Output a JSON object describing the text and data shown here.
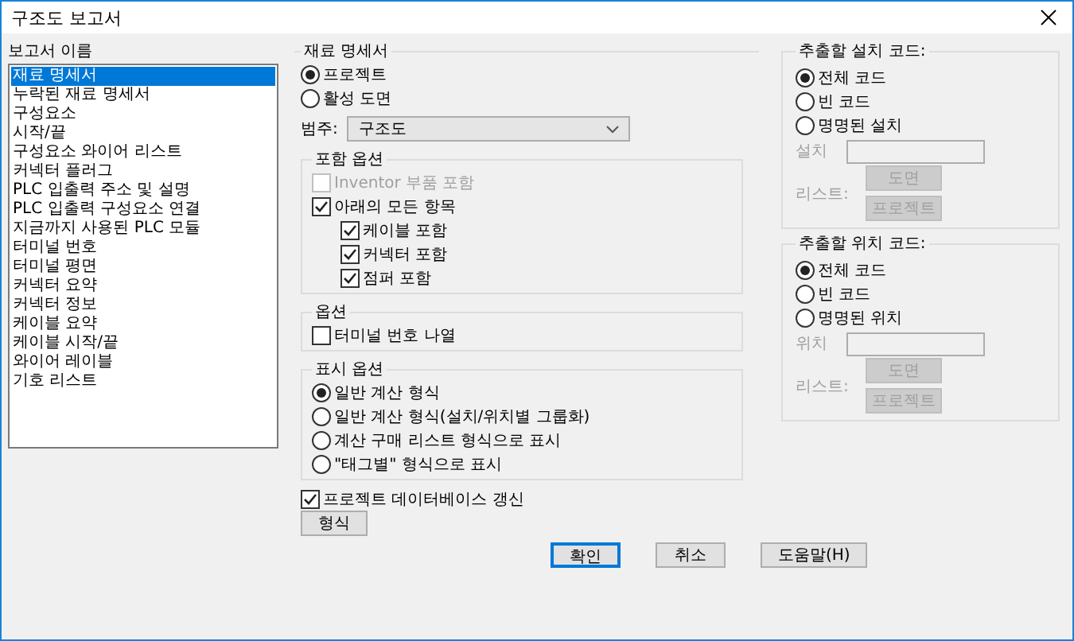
{
  "window": {
    "title": "구조도 보고서"
  },
  "report_list": {
    "label": "보고서 이름",
    "items": [
      {
        "label": "재료 명세서",
        "selected": true
      },
      {
        "label": "누락된 재료 명세서",
        "selected": false
      },
      {
        "label": "구성요소",
        "selected": false
      },
      {
        "label": "시작/끝",
        "selected": false
      },
      {
        "label": "구성요소 와이어 리스트",
        "selected": false
      },
      {
        "label": "커넥터 플러그",
        "selected": false
      },
      {
        "label": "PLC 입출력 주소 및 설명",
        "selected": false
      },
      {
        "label": "PLC 입출력 구성요소 연결",
        "selected": false
      },
      {
        "label": "지금까지 사용된 PLC 모듈",
        "selected": false
      },
      {
        "label": "터미널 번호",
        "selected": false
      },
      {
        "label": "터미널 평면",
        "selected": false
      },
      {
        "label": "커넥터 요약",
        "selected": false
      },
      {
        "label": "커넥터 정보",
        "selected": false
      },
      {
        "label": "케이블 요약",
        "selected": false
      },
      {
        "label": "케이블 시작/끝",
        "selected": false
      },
      {
        "label": "와이어 레이블",
        "selected": false
      },
      {
        "label": "기호 리스트",
        "selected": false
      }
    ]
  },
  "bom": {
    "title": "재료 명세서",
    "scope": [
      {
        "label": "프로젝트",
        "selected": true
      },
      {
        "label": "활성 도면",
        "selected": false
      }
    ],
    "category": {
      "label": "범주:",
      "value": "구조도"
    },
    "include_options": {
      "title": "포함 옵션",
      "items": [
        {
          "label": "Inventor 부품 포함",
          "checked": false,
          "disabled": true
        },
        {
          "label": "아래의 모든 항목",
          "checked": true,
          "disabled": false,
          "children": [
            {
              "label": "케이블 포함",
              "checked": true,
              "disabled": false
            },
            {
              "label": "커넥터 포함",
              "checked": true,
              "disabled": false
            },
            {
              "label": "점퍼 포함",
              "checked": true,
              "disabled": false
            }
          ]
        }
      ]
    },
    "options": {
      "title": "옵션",
      "items": [
        {
          "label": "터미널 번호 나열",
          "checked": false,
          "disabled": false
        }
      ]
    },
    "display_options": {
      "title": "표시 옵션",
      "items": [
        {
          "label": "일반 계산 형식",
          "selected": true
        },
        {
          "label": "일반 계산 형식(설치/위치별 그룹화)",
          "selected": false
        },
        {
          "label": "계산 구매 리스트 형식으로 표시",
          "selected": false
        },
        {
          "label": "\"태그별\" 형식으로 표시",
          "selected": false
        }
      ]
    },
    "update_db": {
      "label": "프로젝트 데이터베이스 갱신",
      "checked": true
    },
    "format_button": "형식"
  },
  "code_groups": [
    {
      "title": "추출할 설치 코드:",
      "options": [
        {
          "label": "전체 코드",
          "selected": true
        },
        {
          "label": "빈 코드",
          "selected": false
        },
        {
          "label": "명명된 설치",
          "selected": false
        }
      ],
      "field_label": "설치",
      "list_label": "리스트:",
      "buttons": [
        "도면",
        "프로젝트"
      ],
      "disabled": true
    },
    {
      "title": "추출할 위치 코드:",
      "options": [
        {
          "label": "전체 코드",
          "selected": true
        },
        {
          "label": "빈 코드",
          "selected": false
        },
        {
          "label": "명명된 위치",
          "selected": false
        }
      ],
      "field_label": "위치",
      "list_label": "리스트:",
      "buttons": [
        "도면",
        "프로젝트"
      ],
      "disabled": true
    }
  ],
  "buttons": [
    {
      "label": "확인",
      "default": true
    },
    {
      "label": "취소",
      "default": false
    },
    {
      "label": "도움말(H)",
      "default": false
    }
  ]
}
